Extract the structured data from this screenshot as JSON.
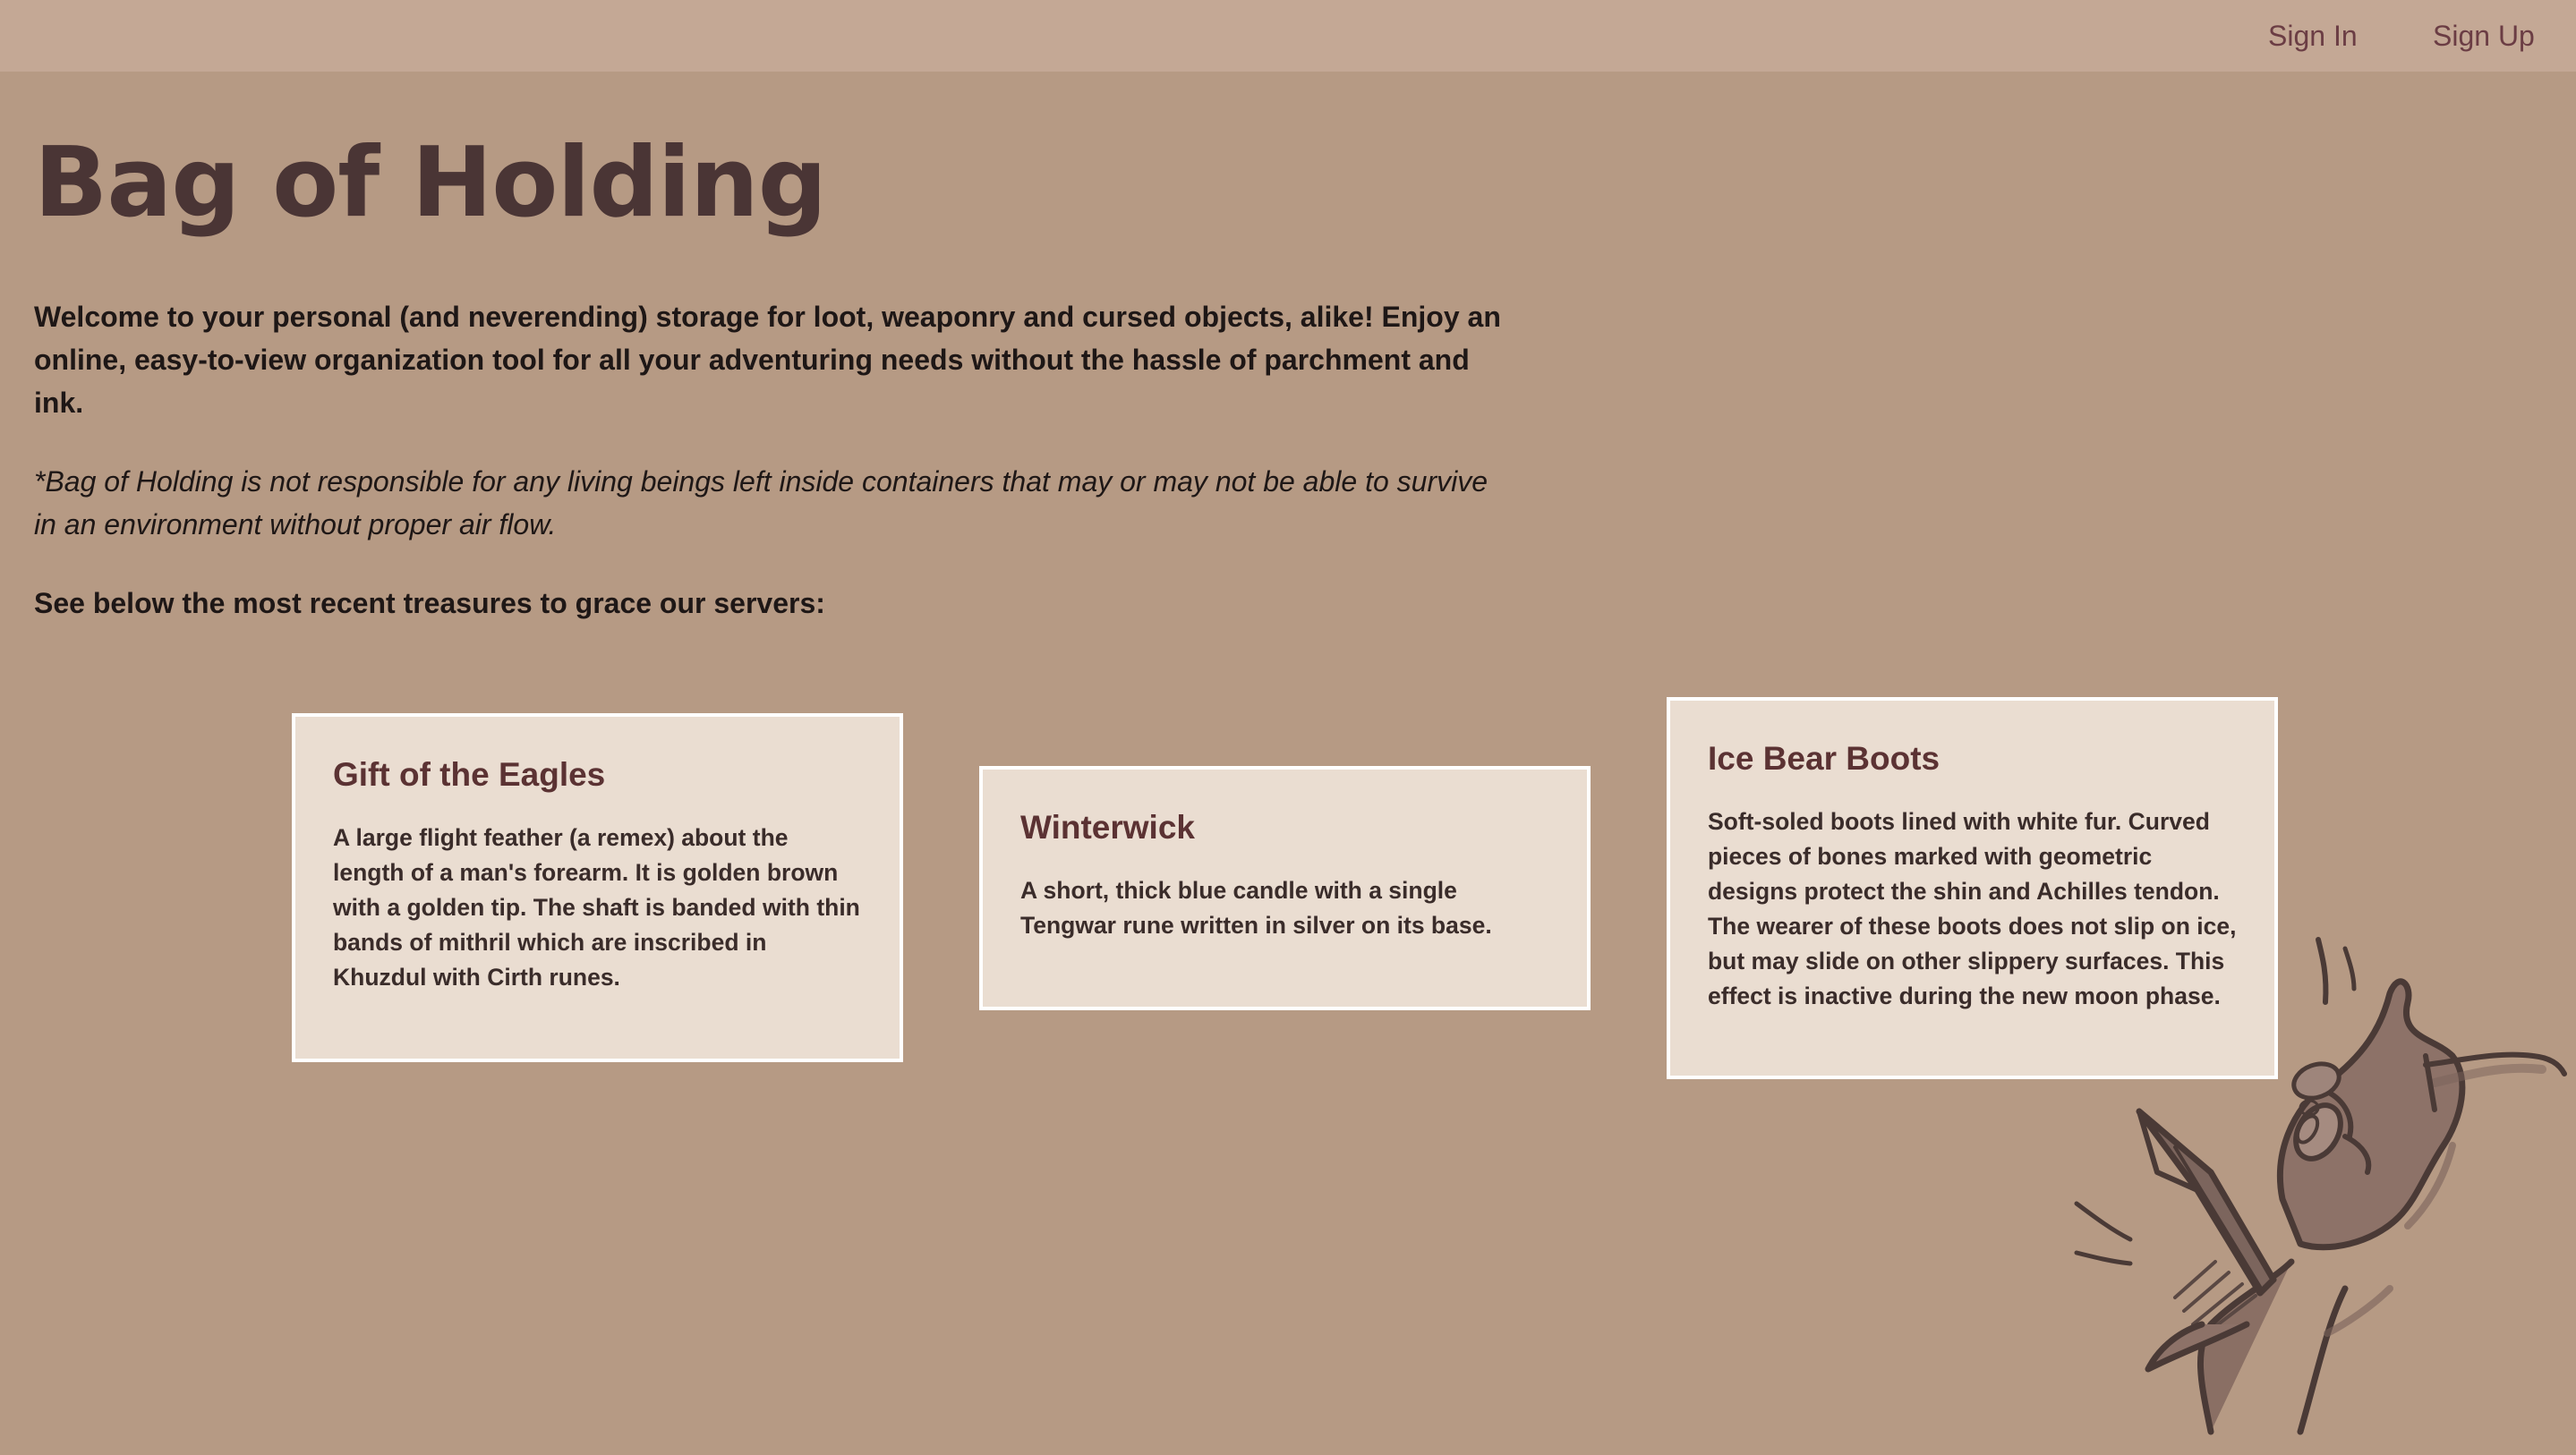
{
  "nav": {
    "sign_in": "Sign In",
    "sign_up": "Sign Up"
  },
  "hero": {
    "title": "Bag of Holding",
    "intro": "Welcome to your personal (and neverending) storage for loot, weaponry and cursed objects, alike! Enjoy an online, easy-to-view organization tool for all your adventuring needs without the hassle of parchment and ink.",
    "disclaimer": "*Bag of Holding is not responsible for any living beings left inside containers that may or may not be able to survive in an environment without proper air flow.",
    "see_below": "See below the most recent treasures to grace our servers:"
  },
  "treasures": [
    {
      "name": "Gift of the Eagles",
      "description": "A large flight feather (a remex) about the length of a man's forearm. It is golden brown with a golden tip. The shaft is banded with thin bands of mithril which are inscribed in Khuzdul with Cirth runes."
    },
    {
      "name": "Winterwick",
      "description": "A short, thick blue candle with a single Tengwar rune written in silver on its base."
    },
    {
      "name": "Ice Bear Boots",
      "description": "Soft-soled boots lined with white fur. Curved pieces of bones marked with geometric designs protect the shin and Achilles tendon. The wearer of these boots does not slip on ice, but may slide on other slippery surfaces. This effect is inactive during the new moon phase."
    }
  ],
  "colors": {
    "background": "#b69a84",
    "topbar": "#c4a895",
    "card": "#eaddd1",
    "heading": "#4a3535",
    "card_title": "#5b3233",
    "link": "#6b3d44"
  },
  "decoration": {
    "illustration_icon": "hand-holding-dagger-illustration"
  }
}
